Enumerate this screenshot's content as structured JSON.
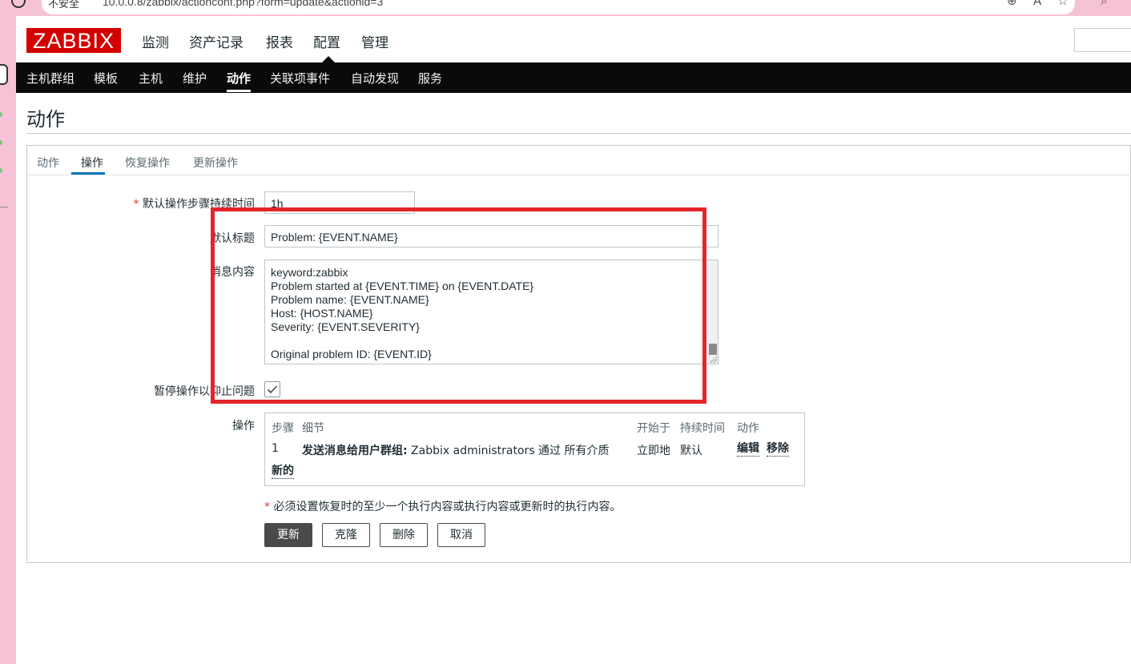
{
  "browser": {
    "secure_label": "不安全",
    "url": "10.0.0.8/zabbix/actionconf.php?form=update&actionid=3"
  },
  "app": {
    "logo": "ZABBIX",
    "main_nav": [
      "监测",
      "资产记录",
      "报表",
      "配置",
      "管理"
    ],
    "main_nav_active": "配置",
    "sub_nav": [
      "主机群组",
      "模板",
      "主机",
      "维护",
      "动作",
      "关联项事件",
      "自动发现",
      "服务"
    ],
    "sub_nav_active": "动作"
  },
  "page": {
    "title": "动作"
  },
  "tabs": [
    "动作",
    "操作",
    "恢复操作",
    "更新操作"
  ],
  "tabs_active": "操作",
  "form": {
    "step_duration": {
      "label": "默认操作步骤持续时间",
      "required_mark": "*",
      "value": "1h"
    },
    "default_subject": {
      "label": "默认标题",
      "value": "Problem: {EVENT.NAME}"
    },
    "message": {
      "label": "消息内容",
      "value": "keyword:zabbix\nProblem started at {EVENT.TIME} on {EVENT.DATE}\nProblem name: {EVENT.NAME}\nHost: {HOST.NAME}\nSeverity: {EVENT.SEVERITY}\n\nOriginal problem ID: {EVENT.ID}\n{TRIGGER.URL}"
    },
    "pause_suppressed": {
      "label": "暂停操作以抑止问题",
      "checked": true
    },
    "operations": {
      "label": "操作",
      "headers": {
        "step": "步骤",
        "details": "细节",
        "start": "开始于",
        "duration": "持续时间",
        "action": "动作"
      },
      "rows": [
        {
          "step": "1",
          "details_bold": "发送消息给用户群组:",
          "details_rest": " Zabbix administrators 通过 所有介质",
          "start": "立即地",
          "duration": "默认",
          "edit": "编辑",
          "remove": "移除"
        }
      ],
      "new_link": "新的"
    },
    "note_mark": "*",
    "note": " 必须设置恢复时的至少一个执行内容或执行内容或更新时的执行内容。",
    "buttons": {
      "update": "更新",
      "clone": "克隆",
      "delete": "删除",
      "cancel": "取消"
    }
  },
  "colors": {
    "brand": "#d40000",
    "highlight": "#e3262b",
    "nav_bg": "#0a0a0a"
  }
}
